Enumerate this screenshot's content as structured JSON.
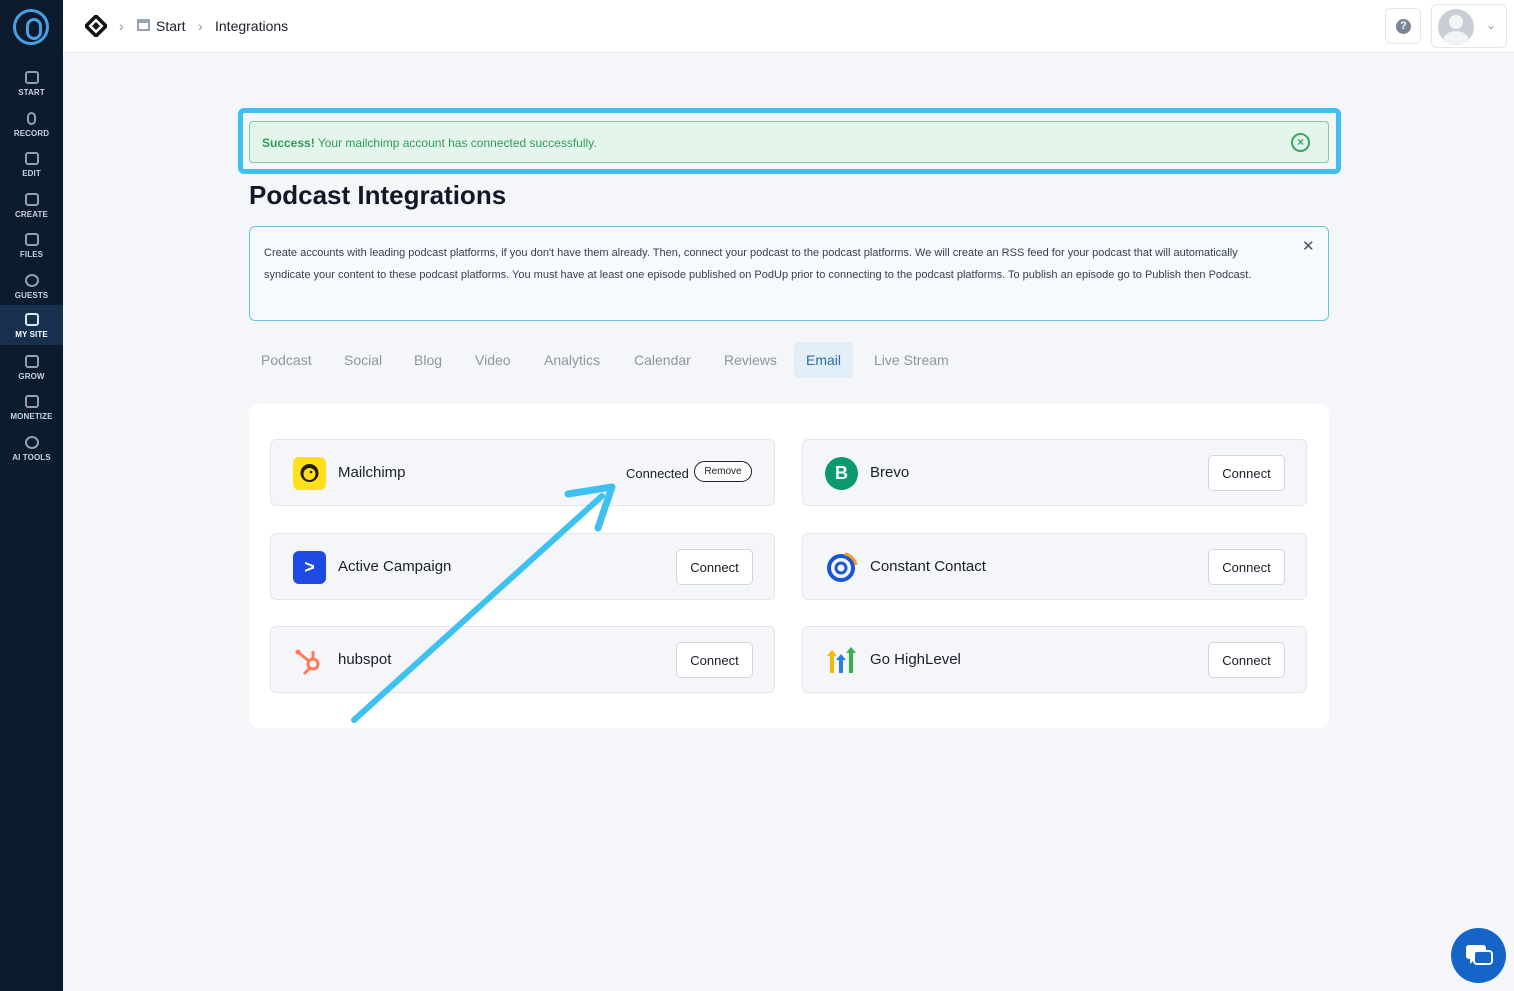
{
  "sidebar": {
    "items": [
      {
        "label": "START",
        "icon": "start-icon"
      },
      {
        "label": "RECORD",
        "icon": "microphone-icon"
      },
      {
        "label": "EDIT",
        "icon": "edit-icon"
      },
      {
        "label": "CREATE",
        "icon": "create-icon"
      },
      {
        "label": "FILES",
        "icon": "files-icon"
      },
      {
        "label": "GUESTS",
        "icon": "guests-icon"
      },
      {
        "label": "MY SITE",
        "icon": "my-site-icon",
        "active": true
      },
      {
        "label": "GROW",
        "icon": "grow-icon"
      },
      {
        "label": "MONETIZE",
        "icon": "monetize-icon"
      },
      {
        "label": "AI TOOLS",
        "icon": "ai-tools-icon"
      }
    ]
  },
  "header": {
    "breadcrumb": [
      "Start",
      "Integrations"
    ]
  },
  "alert": {
    "strong": "Success!",
    "message": " Your mailchimp account has connected successfully."
  },
  "page": {
    "title": "Podcast Integrations",
    "info": "Create accounts with leading podcast platforms, if you don't have them already. Then, connect your podcast to the podcast platforms. We will create an RSS feed for your podcast that will automatically syndicate your content to these podcast platforms. You must have at least one episode published on PodUp prior to connecting to the podcast platforms. To publish an episode go to Publish then Podcast."
  },
  "tabs": [
    "Podcast",
    "Social",
    "Blog",
    "Video",
    "Analytics",
    "Calendar",
    "Reviews",
    "Email",
    "Live Stream"
  ],
  "active_tab": "Email",
  "integrations": [
    {
      "name": "Mailchimp",
      "status": "Connected",
      "action": "Remove",
      "color": "#ffe01b"
    },
    {
      "name": "Brevo",
      "action": "Connect",
      "color": "#0b996e"
    },
    {
      "name": "Active Campaign",
      "action": "Connect",
      "color": "#1e4ae3"
    },
    {
      "name": "Constant Contact",
      "action": "Connect",
      "color": "#1856d8"
    },
    {
      "name": "hubspot",
      "action": "Connect",
      "color": "#ff7a59"
    },
    {
      "name": "Go HighLevel",
      "action": "Connect",
      "color": "#f7b900"
    }
  ],
  "colors": {
    "sidebar_bg": "#0d1b2e",
    "highlight": "#3ec1f0",
    "success_bg": "#e4f6ec",
    "success_text": "#2f9a5c",
    "chat": "#1565c8"
  }
}
